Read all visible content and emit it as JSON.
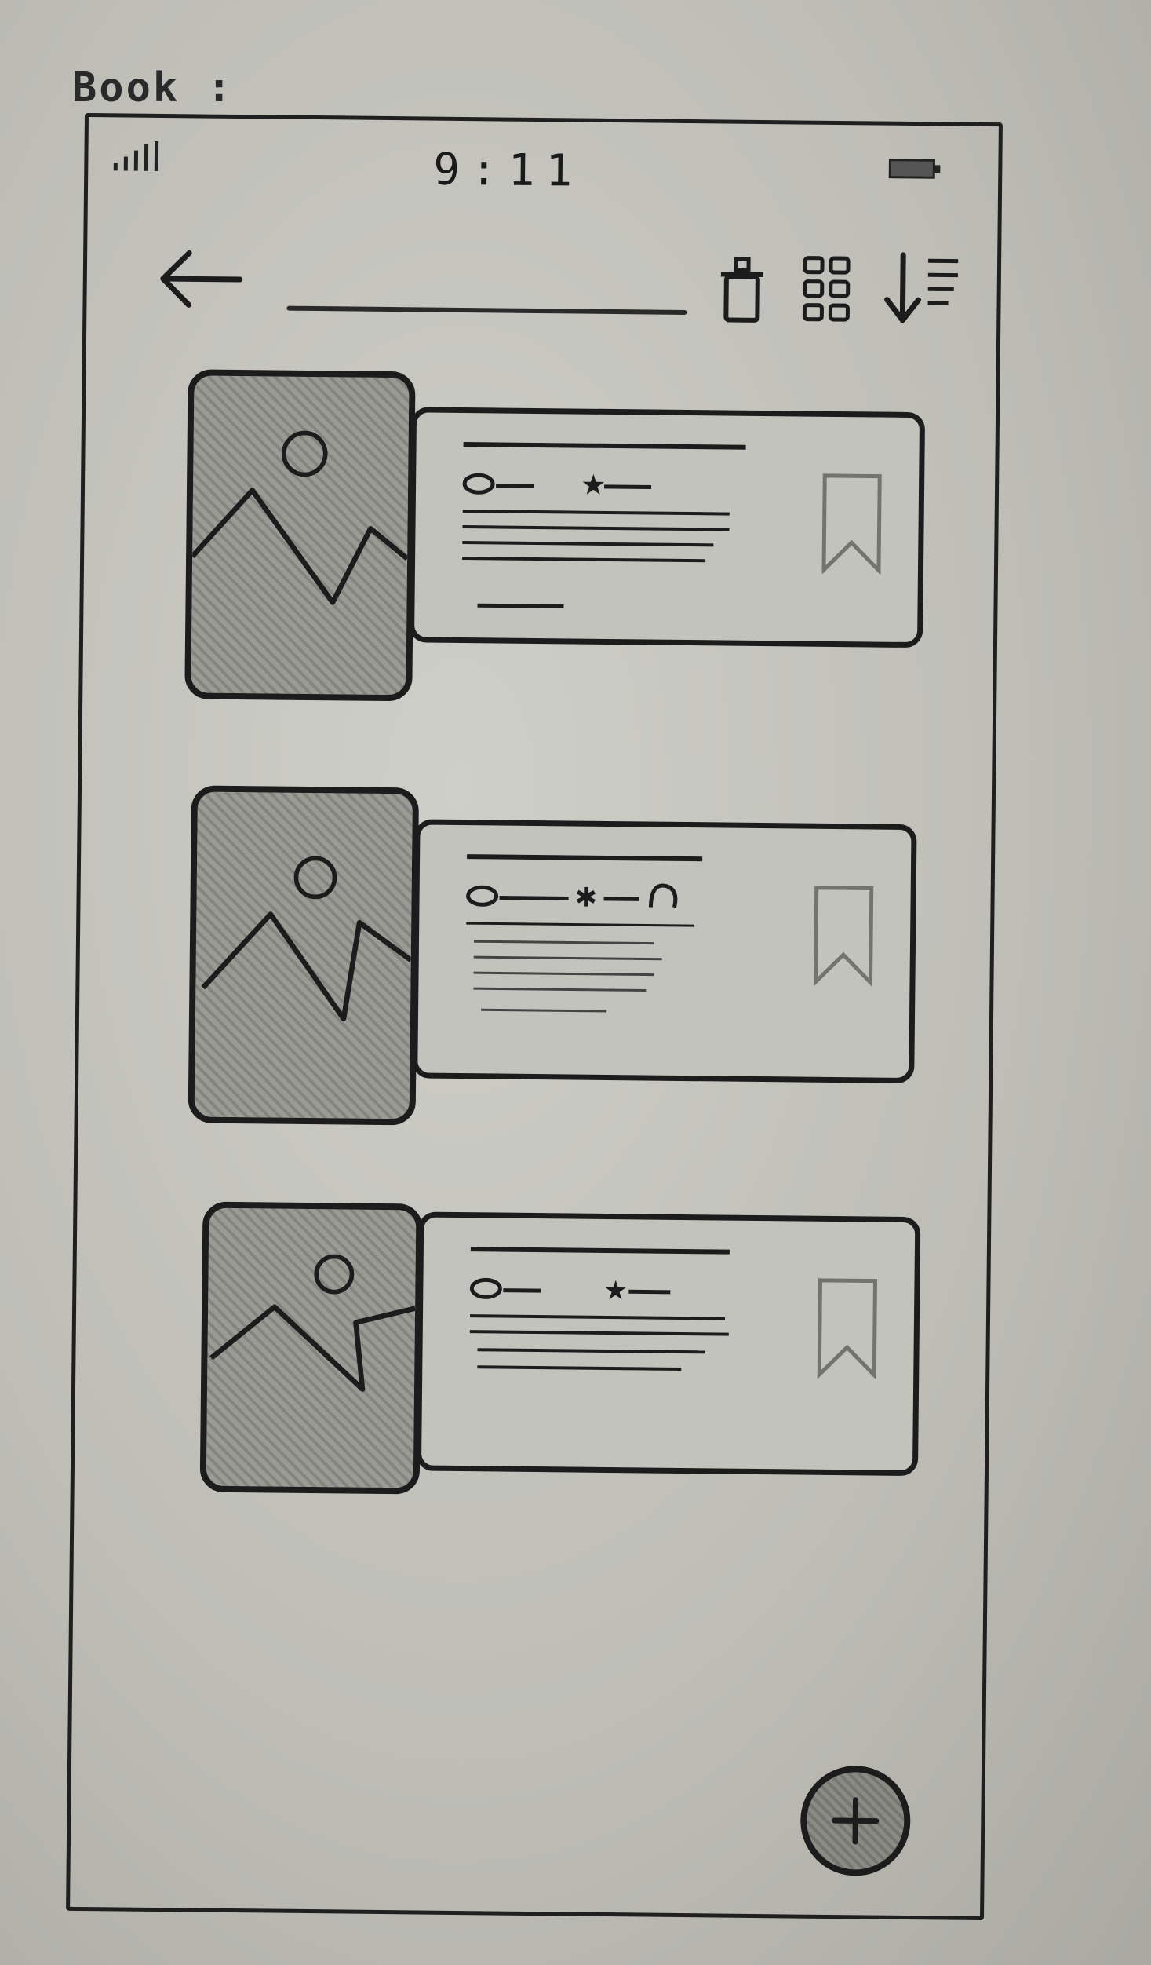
{
  "sheet_label": "Book :",
  "status_bar": {
    "time": "9:11",
    "signal_icon": "signal-icon",
    "battery_icon": "battery-icon"
  },
  "toolbar": {
    "back_icon": "arrow-left-icon",
    "title_placeholder": "",
    "actions": [
      "trash-icon",
      "grid-view-icon",
      "sort-icon"
    ]
  },
  "cards": [
    {
      "image_icon": "image-placeholder-icon",
      "bookmark_icon": "bookmark-icon"
    },
    {
      "image_icon": "image-placeholder-icon",
      "bookmark_icon": "bookmark-icon"
    },
    {
      "image_icon": "image-placeholder-icon",
      "bookmark_icon": "bookmark-icon"
    }
  ],
  "fab": {
    "icon": "plus-icon"
  }
}
